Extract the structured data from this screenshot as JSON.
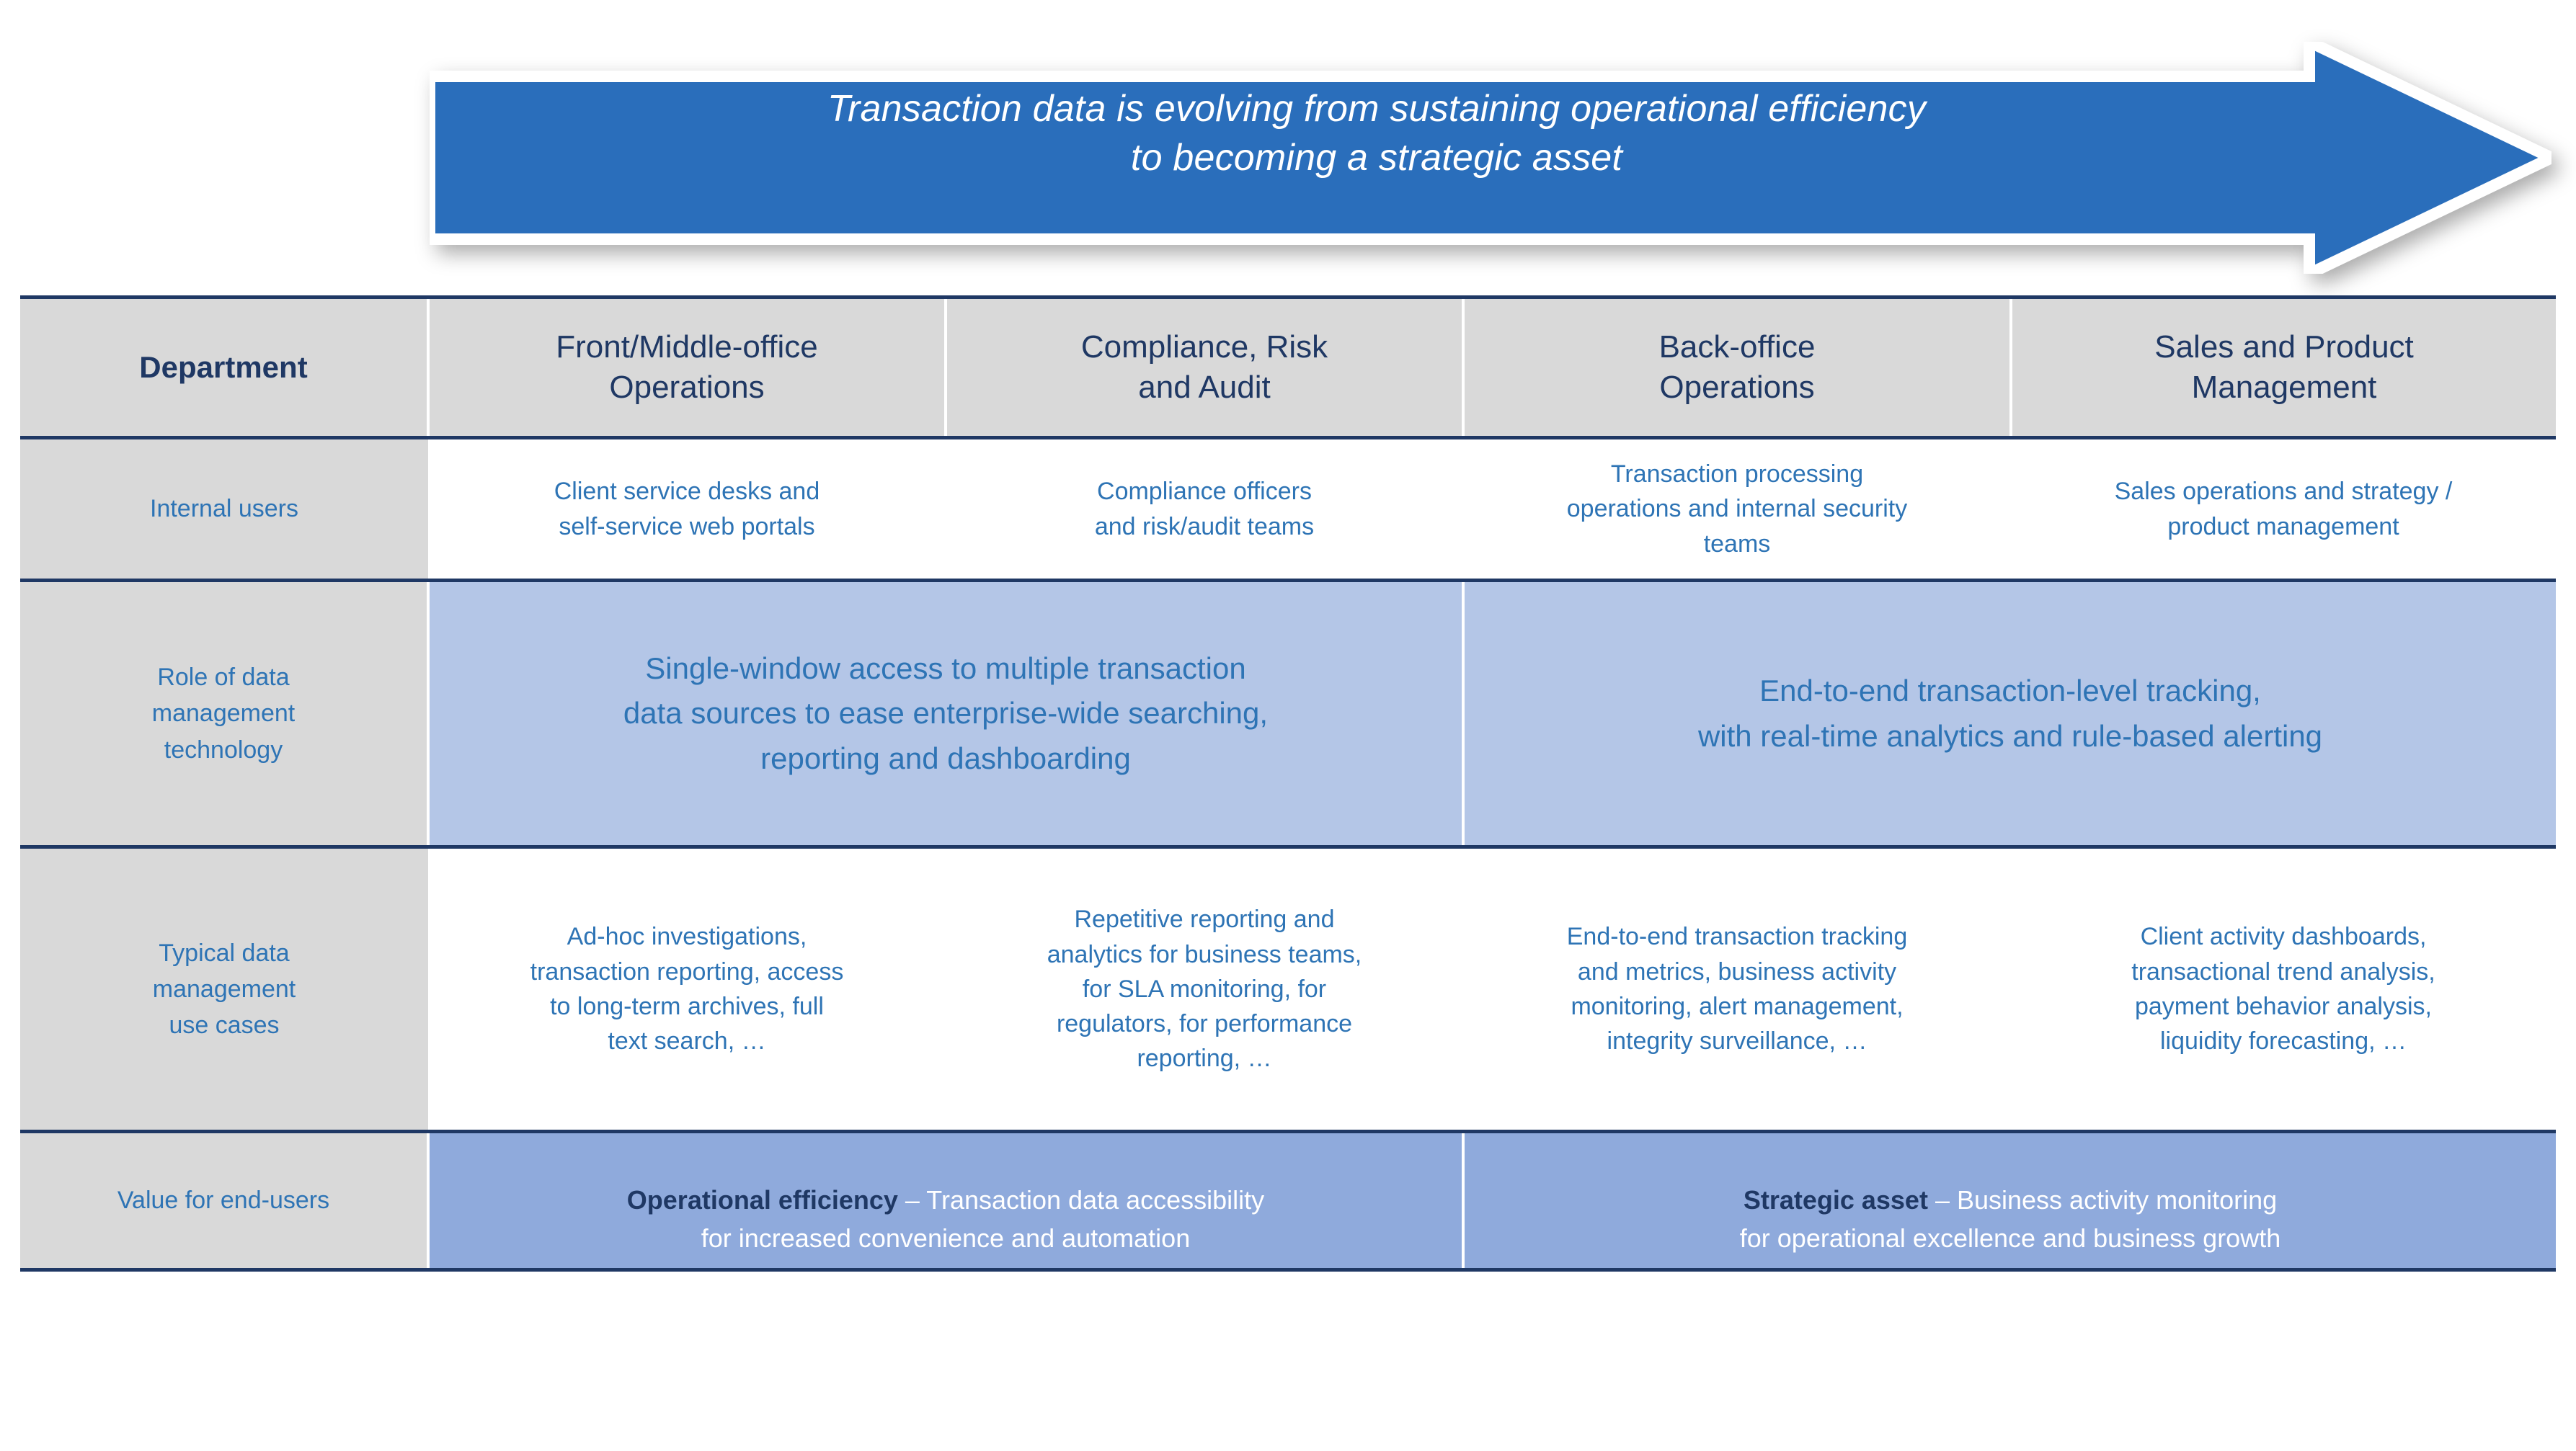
{
  "banner": {
    "text": "Transaction data is evolving from sustaining operational efficiency\nto becoming a strategic asset",
    "fill_color": "#2a6ebb",
    "text_color": "#ffffff",
    "shape": "right-arrow"
  },
  "colors": {
    "header_bg": "#d9d9d9",
    "rowlabel_bg": "#d9d9d9",
    "border": "#1f3864",
    "body_text": "#2e74b5",
    "header_text": "#1f3864",
    "merged_bg": "#b4c6e7",
    "value_bg": "#8faadc",
    "value_text": "#ffffff",
    "value_lead_text": "#1f3864"
  },
  "table": {
    "header": {
      "row_label": "Department",
      "columns": [
        "Front/Middle-office\nOperations",
        "Compliance, Risk\nand Audit",
        "Back-office\nOperations",
        "Sales and Product\nManagement"
      ]
    },
    "rows": [
      {
        "label": "Internal users",
        "cells": [
          "Client service desks and\nself-service web portals",
          "Compliance officers\nand risk/audit teams",
          "Transaction processing\noperations and internal security\nteams",
          "Sales operations and strategy /\nproduct management"
        ]
      },
      {
        "label": "Role of data\nmanagement\ntechnology",
        "merged": [
          {
            "span": 2,
            "text": "Single-window access to multiple transaction\ndata sources to ease enterprise-wide searching,\nreporting and dashboarding"
          },
          {
            "span": 2,
            "text": "End-to-end transaction-level tracking,\nwith real-time analytics and rule-based alerting"
          }
        ]
      },
      {
        "label": "Typical data\nmanagement\nuse cases",
        "cells": [
          "Ad-hoc investigations,\ntransaction reporting, access\nto long-term archives, full\ntext search, …",
          "Repetitive reporting and\nanalytics for business teams,\nfor SLA monitoring, for\nregulators, for performance\nreporting, …",
          "End-to-end transaction tracking\nand metrics, business activity\nmonitoring, alert management,\nintegrity surveillance, …",
          "Client activity dashboards,\ntransactional trend analysis,\npayment behavior analysis,\nliquidity forecasting, …"
        ]
      },
      {
        "label": "Value for end-users",
        "merged": [
          {
            "span": 2,
            "lead": "Operational efficiency",
            "rest": " – Transaction data accessibility\nfor increased convenience and automation"
          },
          {
            "span": 2,
            "lead": "Strategic asset",
            "rest": " – Business activity monitoring\nfor operational excellence and business growth"
          }
        ]
      }
    ]
  }
}
